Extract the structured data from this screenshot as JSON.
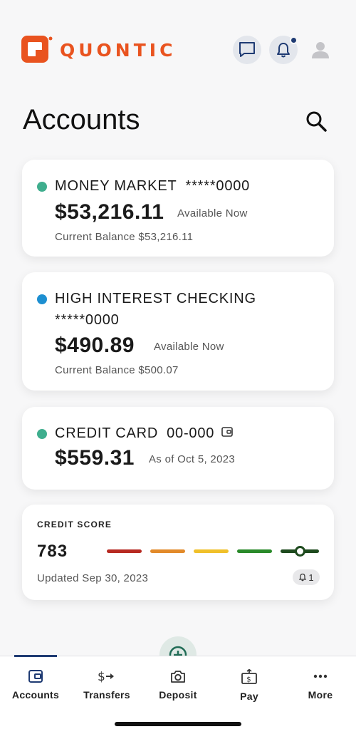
{
  "brand": {
    "name": "QUONTIC",
    "color": "#e9531f"
  },
  "header": {
    "chat_icon": "chat-bubble-icon",
    "notification_icon": "bell-icon",
    "profile_icon": "person-icon"
  },
  "page": {
    "title": "Accounts",
    "search_icon": "search-icon"
  },
  "accounts": [
    {
      "name": "MONEY MARKET",
      "number": "*****0000",
      "dot_color": "#3fae8e",
      "amount": "$53,216.11",
      "amount_label": "Available Now",
      "current_balance": "Current Balance $53,216.11"
    },
    {
      "name": "HIGH INTEREST CHECKING",
      "number": "*****0000",
      "dot_color": "#1d8fd1",
      "amount": "$490.89",
      "amount_label": "Available Now",
      "current_balance": "Current Balance $500.07"
    },
    {
      "name": "CREDIT CARD",
      "number": "00-000",
      "dot_color": "#3fae8e",
      "amount": "$559.31",
      "amount_label": "As of Oct 5, 2023",
      "icon": "wallet-icon"
    }
  ],
  "credit_score": {
    "label": "CREDIT SCORE",
    "score": "783",
    "updated": "Updated Sep 30, 2023",
    "alert_count": "1",
    "bar_colors": [
      "#b72a22",
      "#e28a2a",
      "#f0c02a",
      "#2a8a2a",
      "#1e4a1e"
    ]
  },
  "tabs": [
    {
      "label": "Accounts",
      "icon": "wallet-icon",
      "active": true
    },
    {
      "label": "Transfers",
      "icon": "transfer-icon"
    },
    {
      "label": "Deposit",
      "icon": "camera-icon"
    },
    {
      "label": "Pay",
      "icon": "pay-bill-icon"
    },
    {
      "label": "More",
      "icon": "more-dots-icon"
    }
  ],
  "colors": {
    "nav_accent": "#1f3b73",
    "fab_bg": "#dfe9e5",
    "fab_icon": "#1f6b55"
  }
}
